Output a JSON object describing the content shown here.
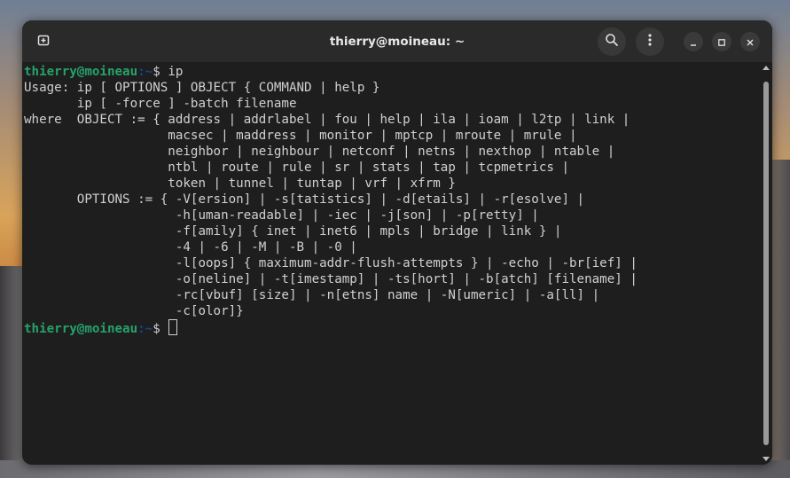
{
  "window": {
    "title": "thierry@moineau: ~"
  },
  "colors": {
    "prompt_user": "#26a269",
    "prompt_path": "#12488b",
    "text": "#d0d0d0",
    "background": "#1e1e1e"
  },
  "icons": {
    "new_tab": "new-tab-icon",
    "search": "search-icon",
    "menu": "kebab-menu-icon",
    "minimize": "minimize-icon",
    "maximize": "maximize-icon",
    "close": "close-icon"
  },
  "terminal": {
    "prompt1": {
      "user_host": "thierry@moineau",
      "path": ":~",
      "symbol": "$ ",
      "command": "ip"
    },
    "output": [
      "Usage: ip [ OPTIONS ] OBJECT { COMMAND | help }",
      "       ip [ -force ] -batch filename",
      "where  OBJECT := { address | addrlabel | fou | help | ila | ioam | l2tp | link |",
      "                   macsec | maddress | monitor | mptcp | mroute | mrule |",
      "                   neighbor | neighbour | netconf | netns | nexthop | ntable |",
      "                   ntbl | route | rule | sr | stats | tap | tcpmetrics |",
      "                   token | tunnel | tuntap | vrf | xfrm }",
      "       OPTIONS := { -V[ersion] | -s[tatistics] | -d[etails] | -r[esolve] |",
      "                    -h[uman-readable] | -iec | -j[son] | -p[retty] |",
      "                    -f[amily] { inet | inet6 | mpls | bridge | link } |",
      "                    -4 | -6 | -M | -B | -0 |",
      "                    -l[oops] { maximum-addr-flush-attempts } | -echo | -br[ief] |",
      "                    -o[neline] | -t[imestamp] | -ts[hort] | -b[atch] [filename] |",
      "                    -rc[vbuf] [size] | -n[etns] name | -N[umeric] | -a[ll] |",
      "                    -c[olor]}"
    ],
    "prompt2": {
      "user_host": "thierry@moineau",
      "path": ":~",
      "symbol": "$ ",
      "command": ""
    }
  }
}
